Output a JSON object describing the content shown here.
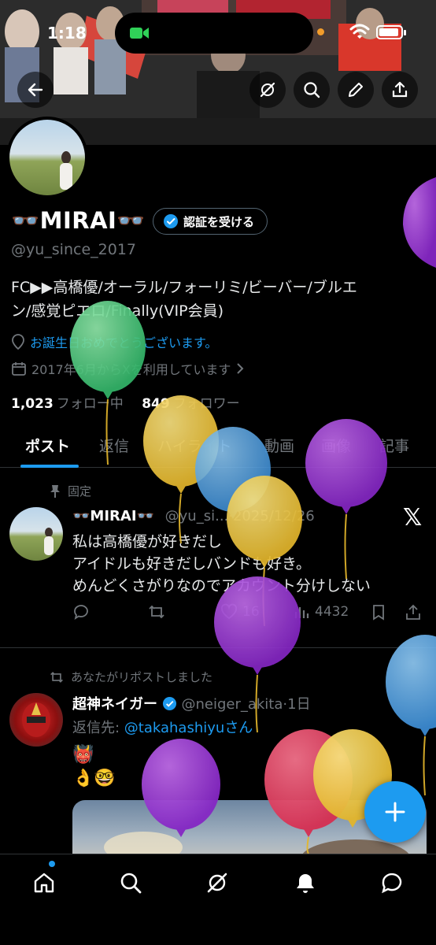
{
  "status_bar": {
    "time": "1:18"
  },
  "profile": {
    "display_name": "👓MIRAI👓",
    "verify_label": "認証を受ける",
    "handle": "@yu_since_2017",
    "bio_line1": "FC▶▶高橋優/オーラル/フォーリミ/ビーバー/ブルエ",
    "bio_line2": "ン/感覚ピエロ/Finally(VIP会員)",
    "birthday": "お誕生日おめでとうございます。",
    "joined": "2017年6月からXを利用しています",
    "following_count": "1,023",
    "following_label": "フォロー中",
    "followers_count": "849",
    "followers_label": "フォロワー"
  },
  "tabs": [
    {
      "label": "ポスト"
    },
    {
      "label": "返信"
    },
    {
      "label": "ハイライト"
    },
    {
      "label": "動画"
    },
    {
      "label": "画像"
    },
    {
      "label": "記事"
    }
  ],
  "pinned_post": {
    "pinned_label": "固定",
    "name": "👓MIRAI👓",
    "handle_date": "@yu_si...·2025/12/26",
    "line1": "私は高橋優が好きだし",
    "line2": "アイドルも好きだしバンドも好き。",
    "line3": "めんどくさがりなのでアカウント分けしない",
    "likes": "16",
    "views": "4432"
  },
  "repost": {
    "repost_label": "あなたがリポストしました",
    "name": "超神ネイガー",
    "handle_date": "@neiger_akita·1日",
    "reply_prefix": "返信先: ",
    "reply_user": "@takahashiyu",
    "reply_suffix": "さん",
    "emoji1": "👹",
    "emoji2": "👌🤓"
  },
  "colors": {
    "accent": "#1d9bf0",
    "background": "#000000",
    "muted": "#71767b",
    "border": "#2f3336"
  },
  "icons": [
    "back-arrow-icon",
    "grok-icon",
    "search-icon",
    "pencil-icon",
    "share-icon",
    "verified-badge-icon",
    "location-pin-icon",
    "calendar-icon",
    "chevron-right-icon",
    "pin-icon",
    "reply-icon",
    "repost-icon",
    "like-icon",
    "views-icon",
    "bookmark-icon",
    "x-logo-icon",
    "plus-icon",
    "home-icon",
    "bell-icon",
    "messages-icon"
  ]
}
